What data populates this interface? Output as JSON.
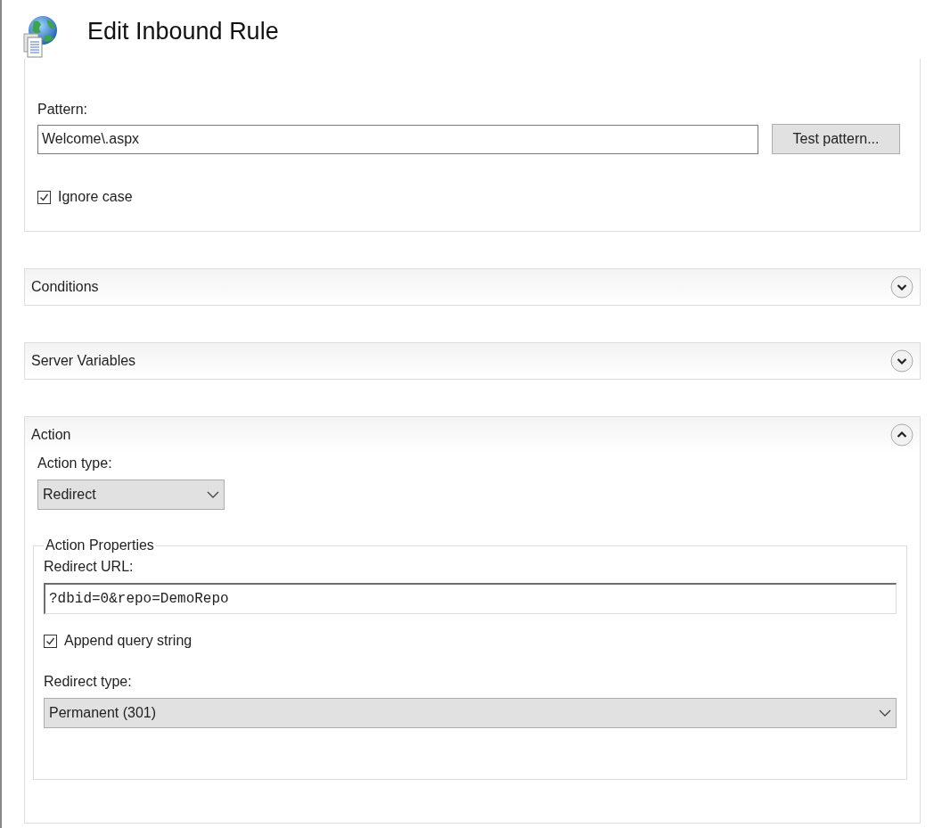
{
  "title": "Edit Inbound Rule",
  "match": {
    "pattern_label": "Pattern:",
    "pattern_value": "Welcome\\.aspx",
    "test_button": "Test pattern...",
    "ignore_case": {
      "label": "Ignore case",
      "checked": true
    }
  },
  "sections": [
    {
      "title": "Conditions",
      "expanded": false
    },
    {
      "title": "Server Variables",
      "expanded": false
    },
    {
      "title": "Action",
      "expanded": true
    }
  ],
  "action": {
    "type_label": "Action type:",
    "type_value": "Redirect",
    "group_title": "Action Properties",
    "url_label": "Redirect URL:",
    "url_value": "?dbid=0&repo=DemoRepo",
    "append_query": {
      "label": "Append query string",
      "checked": true
    },
    "redirect_type_label": "Redirect type:",
    "redirect_type_value": "Permanent (301)"
  }
}
